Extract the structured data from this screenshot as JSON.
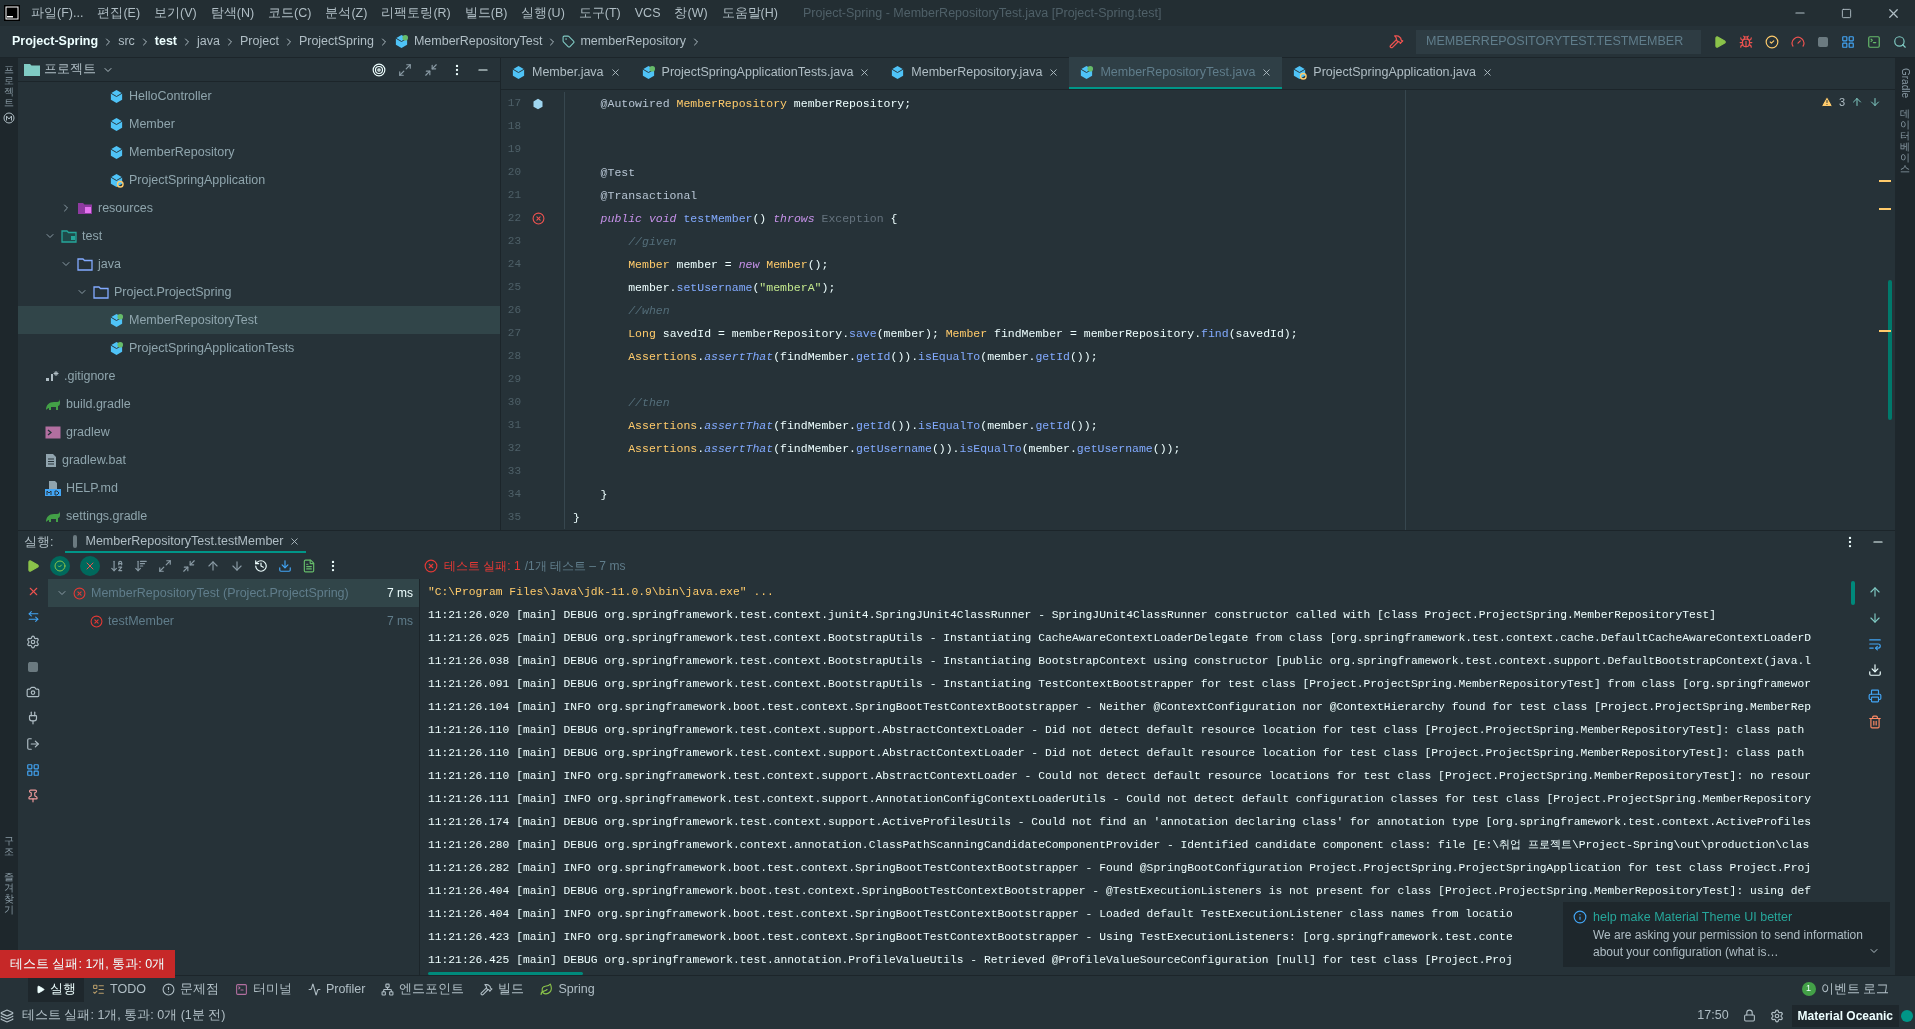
{
  "menu_bar": {
    "items": [
      "파일(F)...",
      "편집(E)",
      "보기(V)",
      "탐색(N)",
      "코드(C)",
      "분석(Z)",
      "리팩토링(R)",
      "빌드(B)",
      "실행(U)",
      "도구(T)",
      "VCS",
      "창(W)",
      "도움말(H)"
    ],
    "title": "Project-Spring - MemberRepositoryTest.java [Project-Spring.test]"
  },
  "breadcrumb": [
    {
      "label": "Project-Spring",
      "bold": true,
      "kind": "text"
    },
    {
      "label": "src",
      "bold": false,
      "kind": "text"
    },
    {
      "label": "test",
      "bold": true,
      "kind": "text"
    },
    {
      "label": "java",
      "bold": false,
      "kind": "text"
    },
    {
      "label": "Project",
      "bold": false,
      "kind": "text"
    },
    {
      "label": "ProjectSpring",
      "bold": false,
      "kind": "text"
    },
    {
      "label": "MemberRepositoryTest",
      "bold": false,
      "kind": "class"
    },
    {
      "label": "memberRepository",
      "bold": false,
      "kind": "field"
    }
  ],
  "run_config": "MEMBERREPOSITORYTEST.TESTMEMBER",
  "left_stripe": {
    "top": "프로젝트",
    "bottom": [
      "구조",
      "즐겨찾기"
    ]
  },
  "right_stripe": [
    "Gradle",
    "데이터베이스"
  ],
  "project_panel": {
    "title": "프로젝트",
    "items": [
      {
        "children": [
          {
            "children": [
              {
                "children": [
                  {
                    "children": [
                      {
                        "label": "HelloController",
                        "kind": "class",
                        "selected": false
                      },
                      {
                        "label": "Member",
                        "kind": "class",
                        "selected": false
                      },
                      {
                        "label": "MemberRepository",
                        "kind": "class",
                        "selected": false
                      },
                      {
                        "label": "ProjectSpringApplication",
                        "kind": "app-class",
                        "selected": false
                      }
                    ]
                  }
                ]
              },
              {
                "label": "resources",
                "kind": "resources-folder",
                "selected": false,
                "expanded": false
              }
            ]
          },
          {
            "label": "test",
            "kind": "test-folder",
            "selected": false,
            "expanded": true,
            "children": [
              {
                "label": "java",
                "kind": "folder",
                "selected": false,
                "expanded": true,
                "children": [
                  {
                    "label": "Project.ProjectSpring",
                    "kind": "folder",
                    "selected": false,
                    "expanded": true,
                    "children": [
                      {
                        "label": "MemberRepositoryTest",
                        "kind": "test-class",
                        "selected": true
                      },
                      {
                        "label": "ProjectSpringApplicationTests",
                        "kind": "test-class",
                        "selected": false
                      }
                    ]
                  }
                ]
              }
            ]
          }
        ]
      },
      {
        "label": ".gitignore",
        "kind": "gitignore",
        "selected": false
      },
      {
        "label": "build.gradle",
        "kind": "gradle",
        "selected": false
      },
      {
        "label": "gradlew",
        "kind": "shell",
        "selected": false
      },
      {
        "label": "gradlew.bat",
        "kind": "file",
        "selected": false
      },
      {
        "label": "HELP.md",
        "kind": "markdown",
        "selected": false
      },
      {
        "label": "settings.gradle",
        "kind": "gradle",
        "selected": false
      }
    ]
  },
  "editor": {
    "tabs": [
      {
        "label": "Member.java",
        "kind": "class",
        "selected": false
      },
      {
        "label": "ProjectSpringApplicationTests.java",
        "kind": "test-class",
        "selected": false
      },
      {
        "label": "MemberRepository.java",
        "kind": "class",
        "selected": false
      },
      {
        "label": "MemberRepositoryTest.java",
        "kind": "test-class",
        "selected": true
      },
      {
        "label": "ProjectSpringApplication.java",
        "kind": "app-class",
        "selected": false
      }
    ],
    "warnings": "3",
    "lines": [
      {
        "n": "17",
        "kind": "bean",
        "tokens": [
          {
            "text": "    @Autowired",
            "kind": "ann"
          },
          {
            "text": " MemberRepository",
            "kind": "type"
          },
          {
            "text": " memberRepository;",
            "kind": "plain"
          }
        ]
      },
      {
        "n": "18",
        "kind": "plain"
      },
      {
        "n": "19",
        "kind": "plain"
      },
      {
        "n": "20",
        "kind": "plain",
        "tokens": [
          {
            "text": "    @Test",
            "kind": "ann"
          }
        ]
      },
      {
        "n": "21",
        "kind": "plain",
        "tokens": [
          {
            "text": "    @Transactional",
            "kind": "ann"
          }
        ]
      },
      {
        "n": "22",
        "kind": "error",
        "tokens": [
          {
            "text": "    public void",
            "kind": "kw"
          },
          {
            "text": " testMember",
            "kind": "fn"
          },
          {
            "text": "() ",
            "kind": "plain"
          },
          {
            "text": "throws",
            "kind": "kw"
          },
          {
            "text": " Exception",
            "kind": "dim"
          },
          {
            "text": " {",
            "kind": "plain"
          }
        ]
      },
      {
        "n": "23",
        "kind": "plain",
        "tokens": [
          {
            "text": "        //given",
            "kind": "cm"
          }
        ]
      },
      {
        "n": "24",
        "kind": "plain",
        "tokens": [
          {
            "text": "        Member",
            "kind": "type"
          },
          {
            "text": " member = ",
            "kind": "plain"
          },
          {
            "text": "new",
            "kind": "kw"
          },
          {
            "text": " Member",
            "kind": "type"
          },
          {
            "text": "();",
            "kind": "plain"
          }
        ]
      },
      {
        "n": "25",
        "kind": "plain",
        "tokens": [
          {
            "text": "        member.",
            "kind": "plain"
          },
          {
            "text": "setUsername",
            "kind": "fn"
          },
          {
            "text": "(",
            "kind": "plain"
          },
          {
            "text": "\"memberA\"",
            "kind": "str"
          },
          {
            "text": ");",
            "kind": "plain"
          }
        ]
      },
      {
        "n": "26",
        "kind": "plain",
        "tokens": [
          {
            "text": "        //when",
            "kind": "cm"
          }
        ]
      },
      {
        "n": "27",
        "kind": "plain",
        "tokens": [
          {
            "text": "        Long",
            "kind": "type"
          },
          {
            "text": " savedId = memberRepository.",
            "kind": "plain"
          },
          {
            "text": "save",
            "kind": "fn"
          },
          {
            "text": "(member); ",
            "kind": "plain"
          },
          {
            "text": "Member",
            "kind": "type"
          },
          {
            "text": " findMember = memberRepository.",
            "kind": "plain"
          },
          {
            "text": "find",
            "kind": "fn"
          },
          {
            "text": "(savedId);",
            "kind": "plain"
          }
        ]
      },
      {
        "n": "28",
        "kind": "plain",
        "tokens": [
          {
            "text": "        Assertions",
            "kind": "type"
          },
          {
            "text": ".",
            "kind": "plain"
          },
          {
            "text": "assertThat",
            "kind": "fni"
          },
          {
            "text": "(findMember.",
            "kind": "plain"
          },
          {
            "text": "getId",
            "kind": "fn"
          },
          {
            "text": "()).",
            "kind": "plain"
          },
          {
            "text": "isEqualTo",
            "kind": "fn"
          },
          {
            "text": "(member.",
            "kind": "plain"
          },
          {
            "text": "getId",
            "kind": "fn"
          },
          {
            "text": "());",
            "kind": "plain"
          }
        ]
      },
      {
        "n": "29",
        "kind": "plain"
      },
      {
        "n": "30",
        "kind": "plain",
        "tokens": [
          {
            "text": "        //then",
            "kind": "cm"
          }
        ]
      },
      {
        "n": "31",
        "kind": "plain",
        "tokens": [
          {
            "text": "        Assertions",
            "kind": "type"
          },
          {
            "text": ".",
            "kind": "plain"
          },
          {
            "text": "assertThat",
            "kind": "fni"
          },
          {
            "text": "(findMember.",
            "kind": "plain"
          },
          {
            "text": "getId",
            "kind": "fn"
          },
          {
            "text": "()).",
            "kind": "plain"
          },
          {
            "text": "isEqualTo",
            "kind": "fn"
          },
          {
            "text": "(member.",
            "kind": "plain"
          },
          {
            "text": "getId",
            "kind": "fn"
          },
          {
            "text": "());",
            "kind": "plain"
          }
        ]
      },
      {
        "n": "32",
        "kind": "plain",
        "tokens": [
          {
            "text": "        Assertions",
            "kind": "type"
          },
          {
            "text": ".",
            "kind": "plain"
          },
          {
            "text": "assertThat",
            "kind": "fni"
          },
          {
            "text": "(findMember.",
            "kind": "plain"
          },
          {
            "text": "getUsername",
            "kind": "fn"
          },
          {
            "text": "()).",
            "kind": "plain"
          },
          {
            "text": "isEqualTo",
            "kind": "fn"
          },
          {
            "text": "(member.",
            "kind": "plain"
          },
          {
            "text": "getUsername",
            "kind": "fn"
          },
          {
            "text": "());",
            "kind": "plain"
          }
        ]
      },
      {
        "n": "33",
        "kind": "plain"
      },
      {
        "n": "34",
        "kind": "plain",
        "tokens": [
          {
            "text": "    }",
            "kind": "plain"
          }
        ]
      },
      {
        "n": "35",
        "kind": "plain",
        "tokens": [
          {
            "text": "}",
            "kind": "plain"
          }
        ]
      }
    ]
  },
  "run_panel": {
    "label": "실행:",
    "tab": "MemberRepositoryTest.testMember",
    "status_failed": "테스트 실패: 1",
    "status_rest": "/1개 테스트 – 7 ms",
    "tests": [
      {
        "name": "MemberRepositoryTest (Project.ProjectSpring)",
        "time": "7 ms",
        "kind": "failed",
        "selected": true,
        "expanded": true,
        "children": [
          {
            "name": "testMember",
            "time": "7 ms",
            "kind": "failed",
            "selected": false
          }
        ]
      }
    ],
    "console": [
      {
        "kind": "command",
        "text": "\"C:\\Program Files\\Java\\jdk-11.0.9\\bin\\java.exe\" ..."
      },
      {
        "kind": "log",
        "text": "11:21:26.020 [main] DEBUG org.springframework.test.context.junit4.SpringJUnit4ClassRunner - SpringJUnit4ClassRunner constructor called with [class Project.ProjectSpring.MemberRepositoryTest]"
      },
      {
        "kind": "log",
        "text": "11:21:26.025 [main] DEBUG org.springframework.test.context.BootstrapUtils - Instantiating CacheAwareContextLoaderDelegate from class [org.springframework.test.context.cache.DefaultCacheAwareContextLoaderD"
      },
      {
        "kind": "log",
        "text": "11:21:26.038 [main] DEBUG org.springframework.test.context.BootstrapUtils - Instantiating BootstrapContext using constructor [public org.springframework.test.context.support.DefaultBootstrapContext(java.l"
      },
      {
        "kind": "log",
        "text": "11:21:26.091 [main] DEBUG org.springframework.test.context.BootstrapUtils - Instantiating TestContextBootstrapper for test class [Project.ProjectSpring.MemberRepositoryTest] from class [org.springframewor"
      },
      {
        "kind": "log",
        "text": "11:21:26.104 [main] INFO org.springframework.boot.test.context.SpringBootTestContextBootstrapper - Neither @ContextConfiguration nor @ContextHierarchy found for test class [Project.ProjectSpring.MemberRep"
      },
      {
        "kind": "log",
        "text": "11:21:26.110 [main] DEBUG org.springframework.test.context.support.AbstractContextLoader - Did not detect default resource location for test class [Project.ProjectSpring.MemberRepositoryTest]: class path"
      },
      {
        "kind": "log",
        "text": "11:21:26.110 [main] DEBUG org.springframework.test.context.support.AbstractContextLoader - Did not detect default resource location for test class [Project.ProjectSpring.MemberRepositoryTest]: class path"
      },
      {
        "kind": "log",
        "text": "11:21:26.110 [main] INFO org.springframework.test.context.support.AbstractContextLoader - Could not detect default resource locations for test class [Project.ProjectSpring.MemberRepositoryTest]: no resour"
      },
      {
        "kind": "log",
        "text": "11:21:26.111 [main] INFO org.springframework.test.context.support.AnnotationConfigContextLoaderUtils - Could not detect default configuration classes for test class [Project.ProjectSpring.MemberRepository"
      },
      {
        "kind": "log",
        "text": "11:21:26.174 [main] DEBUG org.springframework.test.context.support.ActiveProfilesUtils - Could not find an 'annotation declaring class' for annotation type [org.springframework.test.context.ActiveProfiles"
      },
      {
        "kind": "log",
        "text": "11:21:26.280 [main] DEBUG org.springframework.context.annotation.ClassPathScanningCandidateComponentProvider - Identified candidate component class: file [E:\\취업 프로젝트\\Project-Spring\\out\\production\\clas"
      },
      {
        "kind": "log",
        "text": "11:21:26.282 [main] INFO org.springframework.boot.test.context.SpringBootTestContextBootstrapper - Found @SpringBootConfiguration Project.ProjectSpring.ProjectSpringApplication for test class Project.Proj"
      },
      {
        "kind": "log",
        "text": "11:21:26.404 [main] DEBUG org.springframework.boot.test.context.SpringBootTestContextBootstrapper - @TestExecutionListeners is not present for class [Project.ProjectSpring.MemberRepositoryTest]: using def"
      },
      {
        "kind": "log",
        "text": "11:21:26.404 [main] INFO org.springframework.boot.test.context.SpringBootTestContextBootstrapper - Loaded default TestExecutionListener class names from locatio"
      },
      {
        "kind": "log",
        "text": "11:21:26.423 [main] INFO org.springframework.boot.test.context.SpringBootTestContextBootstrapper - Using TestExecutionListeners: [org.springframework.test.conte"
      },
      {
        "kind": "log",
        "text": "11:21:26.425 [main] DEBUG org.springframework.test.annotation.ProfileValueUtils - Retrieved @ProfileValueSourceConfiguration [null] for test class [Project.Proj"
      }
    ]
  },
  "balloon": "테스트 실패: 1개, 통과: 0개",
  "notification": {
    "title": "help make Material Theme UI better",
    "body": "We are asking your permission to send information about your configuration (what is…"
  },
  "tool_windows": [
    {
      "label": "실행",
      "kind": "run",
      "selected": true
    },
    {
      "label": "TODO",
      "kind": "todo",
      "selected": false
    },
    {
      "label": "문제점",
      "kind": "problems",
      "selected": false
    },
    {
      "label": "터미널",
      "kind": "terminal",
      "selected": false
    },
    {
      "label": "Profiler",
      "kind": "profiler",
      "selected": false
    },
    {
      "label": "엔드포인트",
      "kind": "endpoints",
      "selected": false
    },
    {
      "label": "빌드",
      "kind": "build",
      "selected": false
    },
    {
      "label": "Spring",
      "kind": "spring",
      "selected": false
    }
  ],
  "event_log": {
    "count": "1",
    "label": "이벤트 로그"
  },
  "status_bar": {
    "message": "테스트 실패: 1개, 통과: 0개 (1분 전)",
    "time": "17:50",
    "theme": "Material Oceanic"
  }
}
